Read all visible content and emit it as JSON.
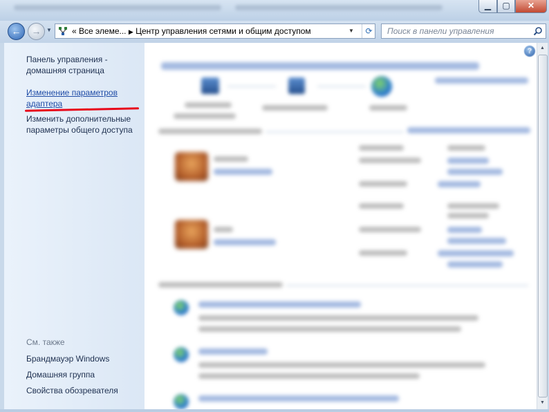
{
  "address_bar": {
    "prefix": "«",
    "path": [
      "Все элеме...",
      "Центр управления сетями и общим доступом"
    ]
  },
  "search": {
    "placeholder": "Поиск в панели управления"
  },
  "sidebar": {
    "items": [
      {
        "label": "Панель управления - домашняя страница",
        "lines": [
          "Панель управления -",
          "домашняя страница"
        ]
      },
      {
        "label": "Изменение параметров адаптера",
        "lines": [
          "Изменение параметров",
          "адаптера"
        ]
      },
      {
        "label": "Изменить дополнительные параметры общего доступа",
        "lines": [
          "Изменить дополнительные",
          "параметры общего доступа"
        ]
      }
    ],
    "see_also_heading": "См. также",
    "see_also": [
      "Брандмауэр Windows",
      "Домашняя группа",
      "Свойства обозревателя"
    ]
  },
  "annotation_color": "#e8081a",
  "icons": [
    "back-arrow-icon",
    "forward-arrow-icon",
    "network-center-icon",
    "refresh-icon",
    "search-icon",
    "help-icon",
    "globe-icon",
    "computer-icon",
    "house-network-icon"
  ]
}
